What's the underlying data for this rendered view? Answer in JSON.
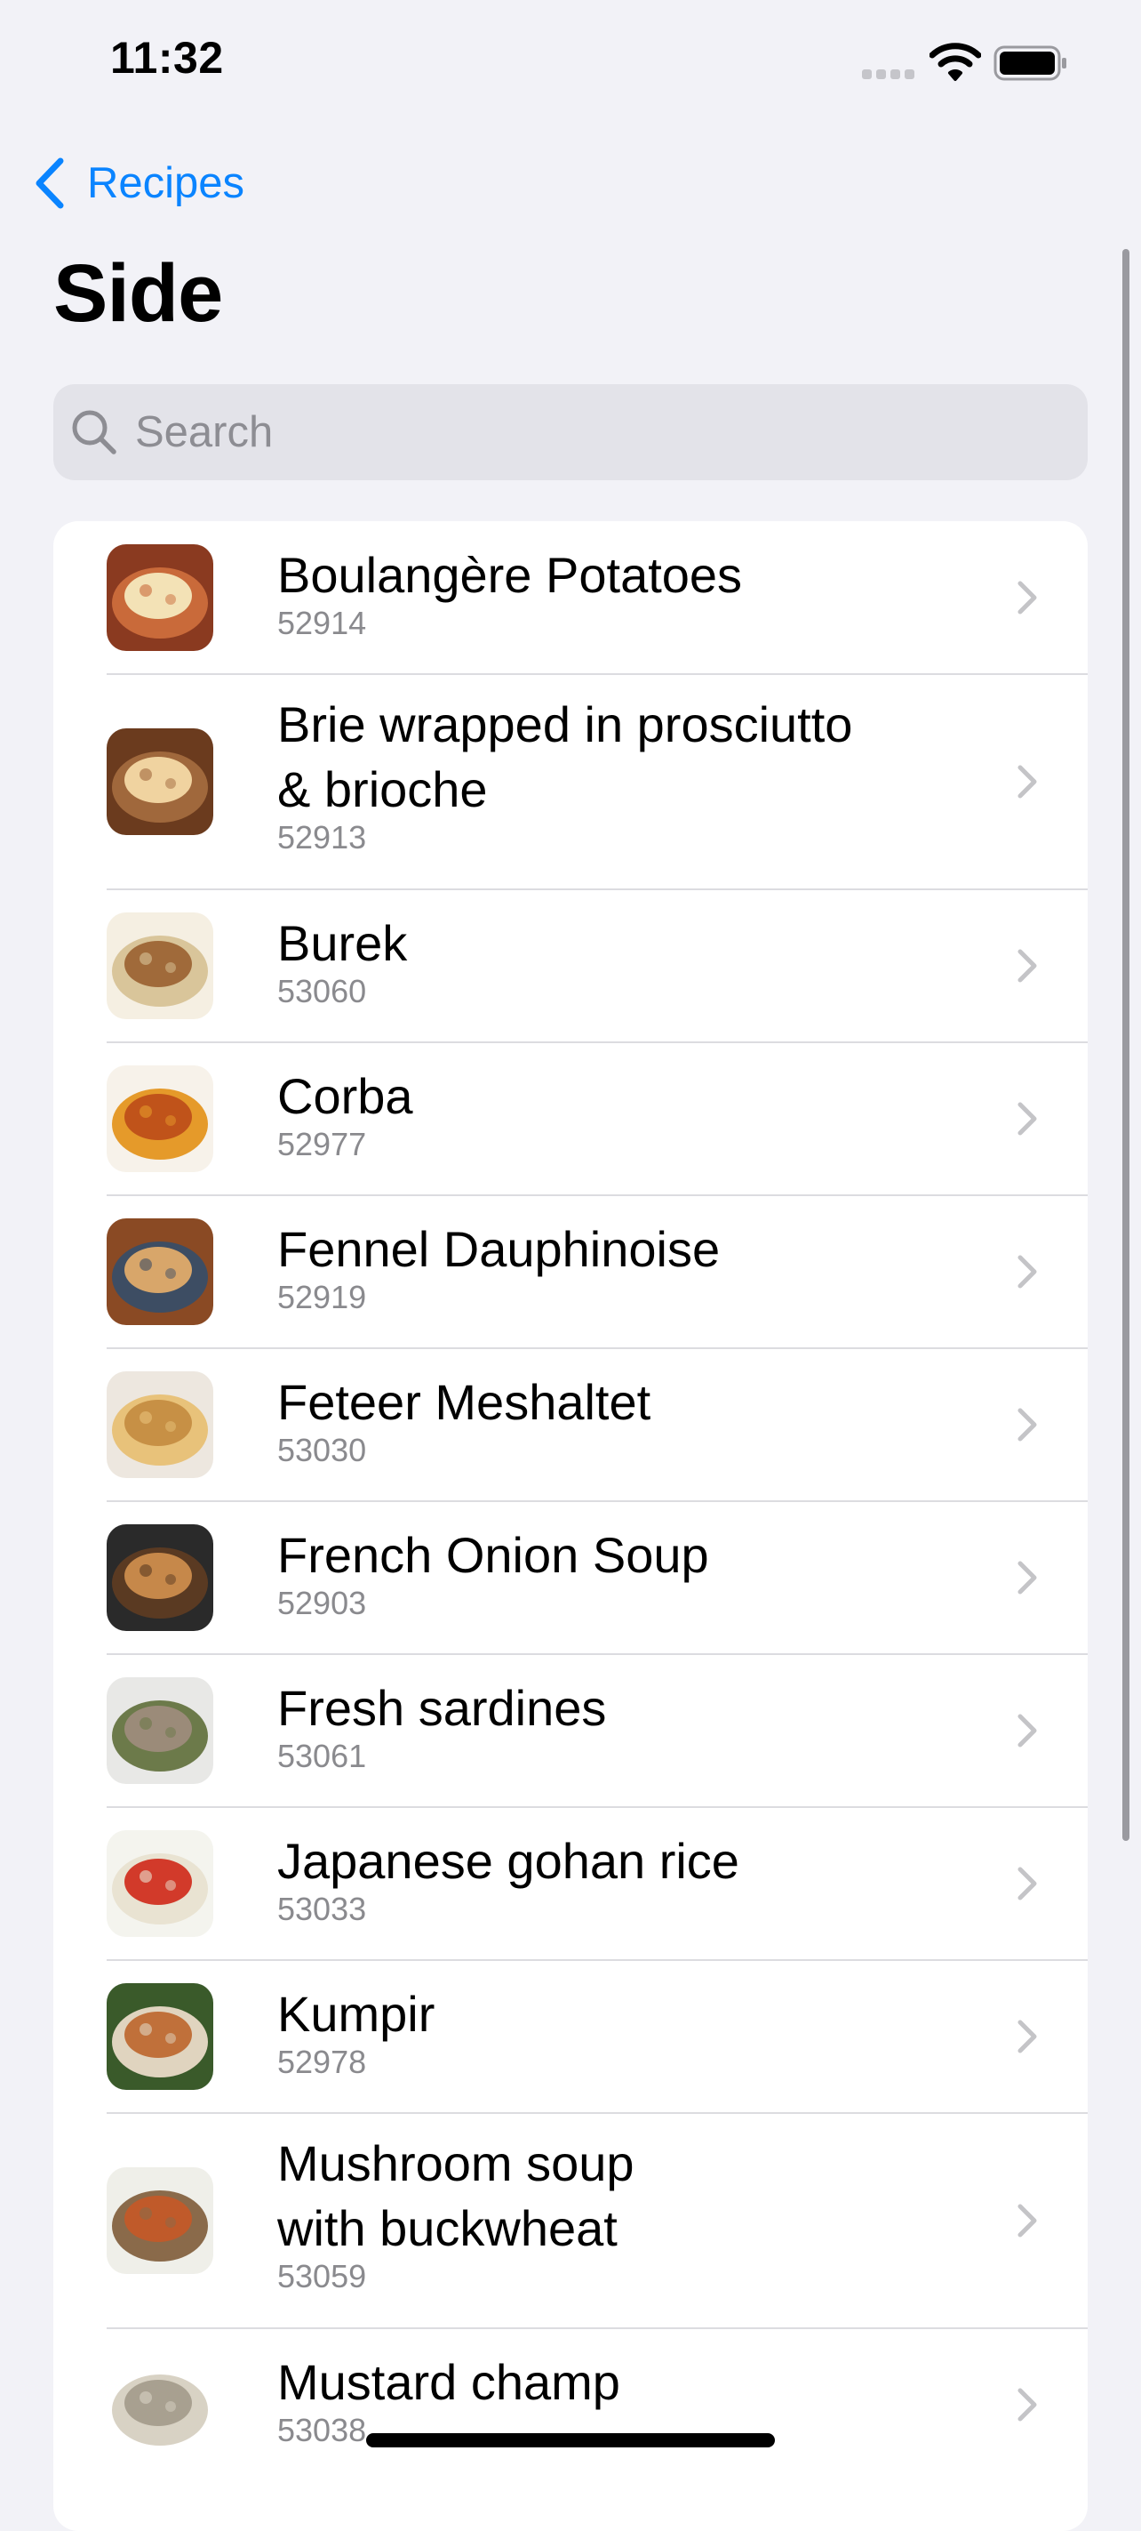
{
  "status_bar": {
    "time": "11:32",
    "icons": [
      "cellular-signal-icon",
      "wifi-icon",
      "battery-icon"
    ]
  },
  "nav": {
    "back_label": "Recipes",
    "title": "Side"
  },
  "search": {
    "placeholder": "Search",
    "value": ""
  },
  "colors": {
    "accent": "#0a84ff",
    "background": "#f2f2f7",
    "secondary_text": "#8a8a8e",
    "separator": "#dcdce0"
  },
  "recipes": [
    {
      "name": "Boulangère Potatoes",
      "id": "52914"
    },
    {
      "name": "Brie wrapped in prosciutto\n& brioche",
      "id": "52913"
    },
    {
      "name": "Burek",
      "id": "53060"
    },
    {
      "name": "Corba",
      "id": "52977"
    },
    {
      "name": "Fennel Dauphinoise",
      "id": "52919"
    },
    {
      "name": "Feteer Meshaltet",
      "id": "53030"
    },
    {
      "name": "French Onion Soup",
      "id": "52903"
    },
    {
      "name": "Fresh sardines",
      "id": "53061"
    },
    {
      "name": "Japanese gohan rice",
      "id": "53033"
    },
    {
      "name": "Kumpir",
      "id": "52978"
    },
    {
      "name": "Mushroom soup\nwith buckwheat",
      "id": "53059"
    },
    {
      "name": "Mustard champ",
      "id": "53038"
    }
  ]
}
